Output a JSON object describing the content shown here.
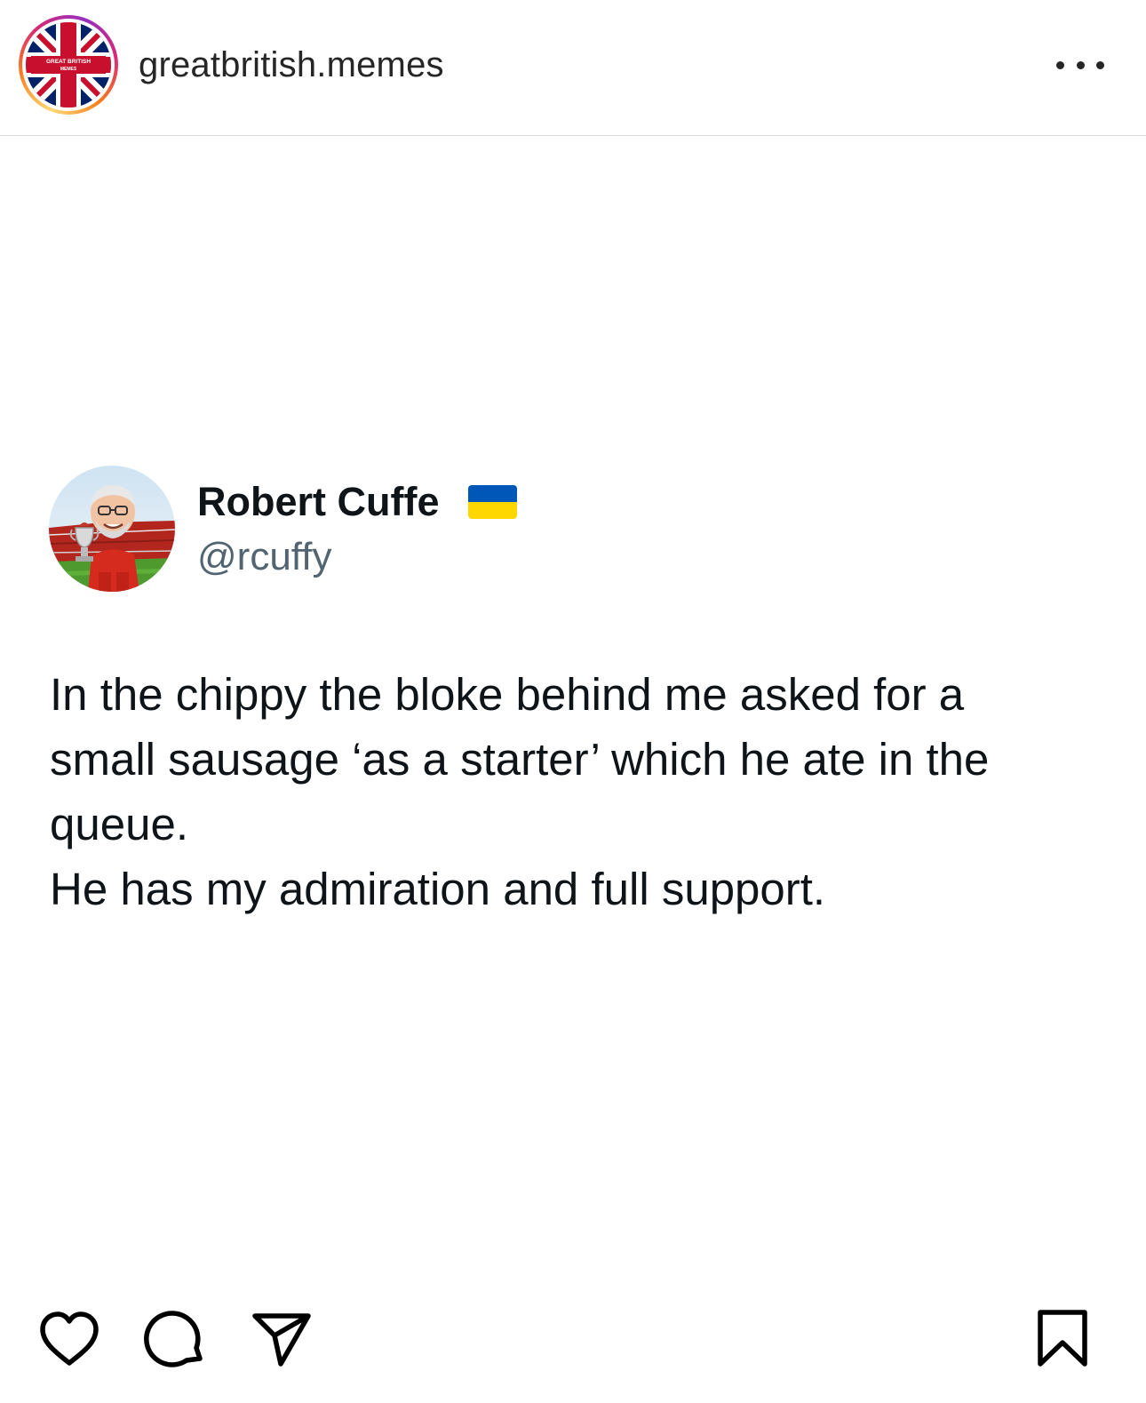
{
  "post": {
    "account_name": "greatbritish.memes",
    "avatar": {
      "icon": "union-jack-logo",
      "logo_text": "GREAT BRITISH MEMES"
    },
    "more_icon": "more-horizontal-icon"
  },
  "tweet": {
    "display_name": "Robert Cuffe",
    "flag_emoji": "🇺🇦",
    "handle": "@rcuffy",
    "lines": [
      "In the chippy the bloke behind me asked for a",
      "small sausage ‘as a starter’ which he ate in the",
      "queue.",
      "He has my admiration and full support."
    ]
  },
  "actions": {
    "like_icon": "heart-icon",
    "comment_icon": "comment-icon",
    "share_icon": "send-icon",
    "save_icon": "bookmark-icon"
  },
  "colors": {
    "text_primary": "#262626",
    "tweet_text": "#0f1419",
    "handle": "#536471",
    "divider": "#dbdbdb"
  }
}
